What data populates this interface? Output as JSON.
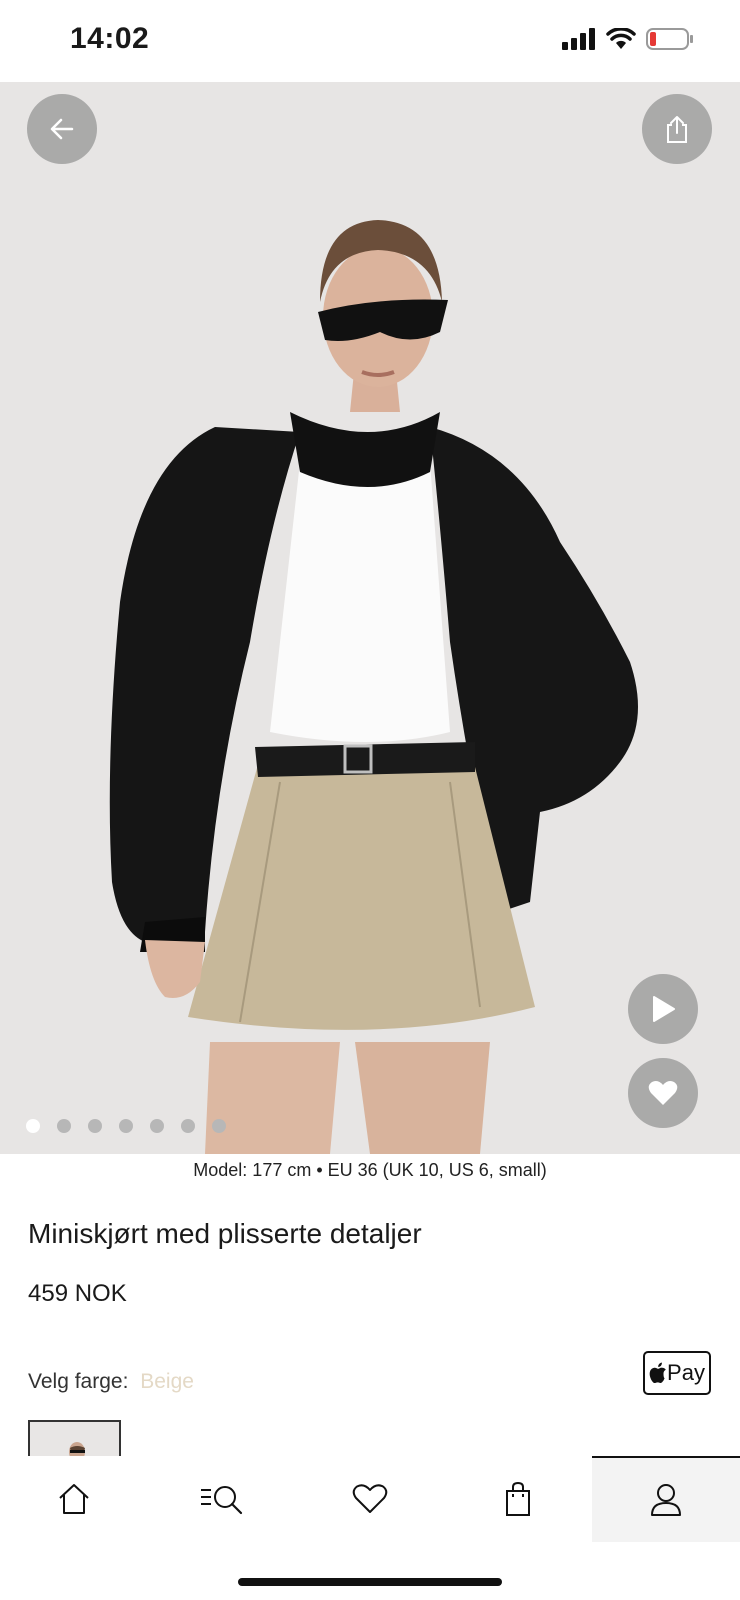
{
  "status": {
    "time": "14:02"
  },
  "product": {
    "model_info": "Model: 177 cm • EU 36 (UK 10, US 6, small)",
    "name": "Miniskjørt med plisserte detaljer",
    "price": "459 NOK",
    "color_label": "Velg farge:",
    "color_value": "Beige",
    "apple_pay_label": "Pay"
  },
  "gallery": {
    "image_count": 7,
    "active_index": 0
  },
  "nav": {
    "items": [
      {
        "name": "home",
        "icon": "home-icon"
      },
      {
        "name": "browse",
        "icon": "menu-search-icon"
      },
      {
        "name": "wishlist",
        "icon": "heart-icon"
      },
      {
        "name": "bag",
        "icon": "bag-icon"
      },
      {
        "name": "account",
        "icon": "user-icon",
        "active": true
      }
    ]
  },
  "colors": {
    "accent_beige": "#e4d9c6",
    "battery_low": "#e53935"
  }
}
